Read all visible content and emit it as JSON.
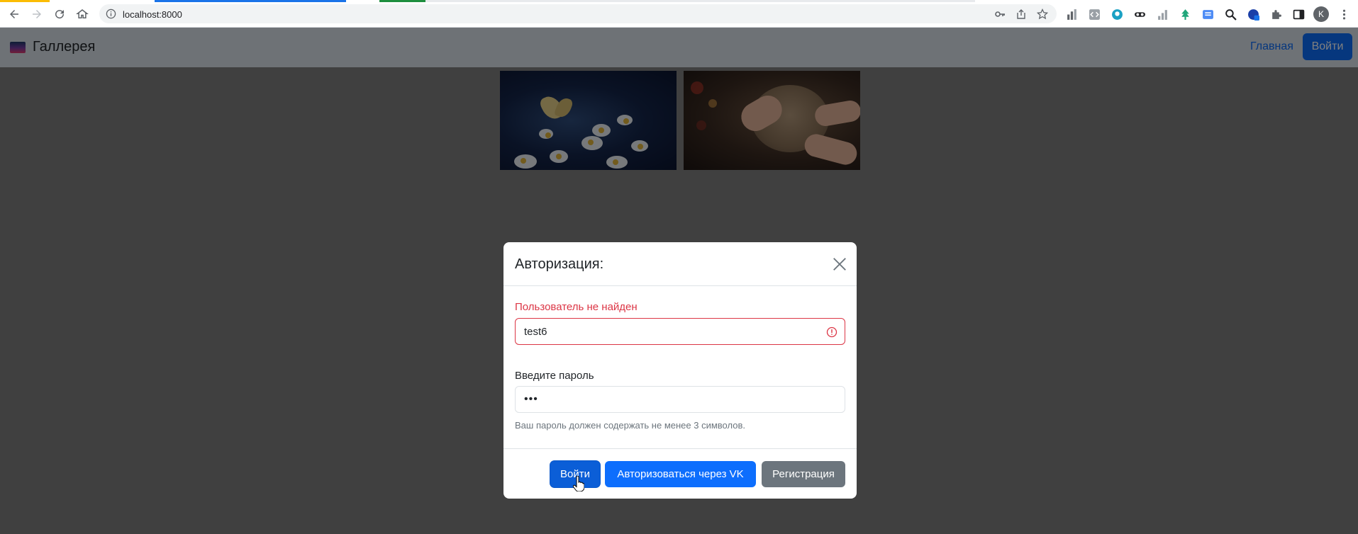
{
  "browser": {
    "url": "localhost:8000",
    "tab_colors": [
      "#fbbc04",
      "#1a73e8",
      "#1e8e3e"
    ],
    "profile_initial": "K"
  },
  "navbar": {
    "brand": "Галлерея",
    "home_link": "Главная",
    "login_button": "Войти"
  },
  "gallery": {
    "images": [
      {
        "name": "butterfly-daisies"
      },
      {
        "name": "cat-being-petted"
      }
    ]
  },
  "modal": {
    "title": "Авторизация:",
    "error_message": "Пользователь не найден",
    "login_value": "test6",
    "password_label": "Введите пароль",
    "password_value": "•••",
    "password_help": "Ваш пароль должен содержать не менее 3 символов.",
    "buttons": {
      "login": "Войти",
      "vk": "Авторизоваться через VK",
      "register": "Регистрация"
    }
  },
  "colors": {
    "primary": "#0d6efd",
    "danger": "#dc3545",
    "secondary": "#6c757d"
  }
}
